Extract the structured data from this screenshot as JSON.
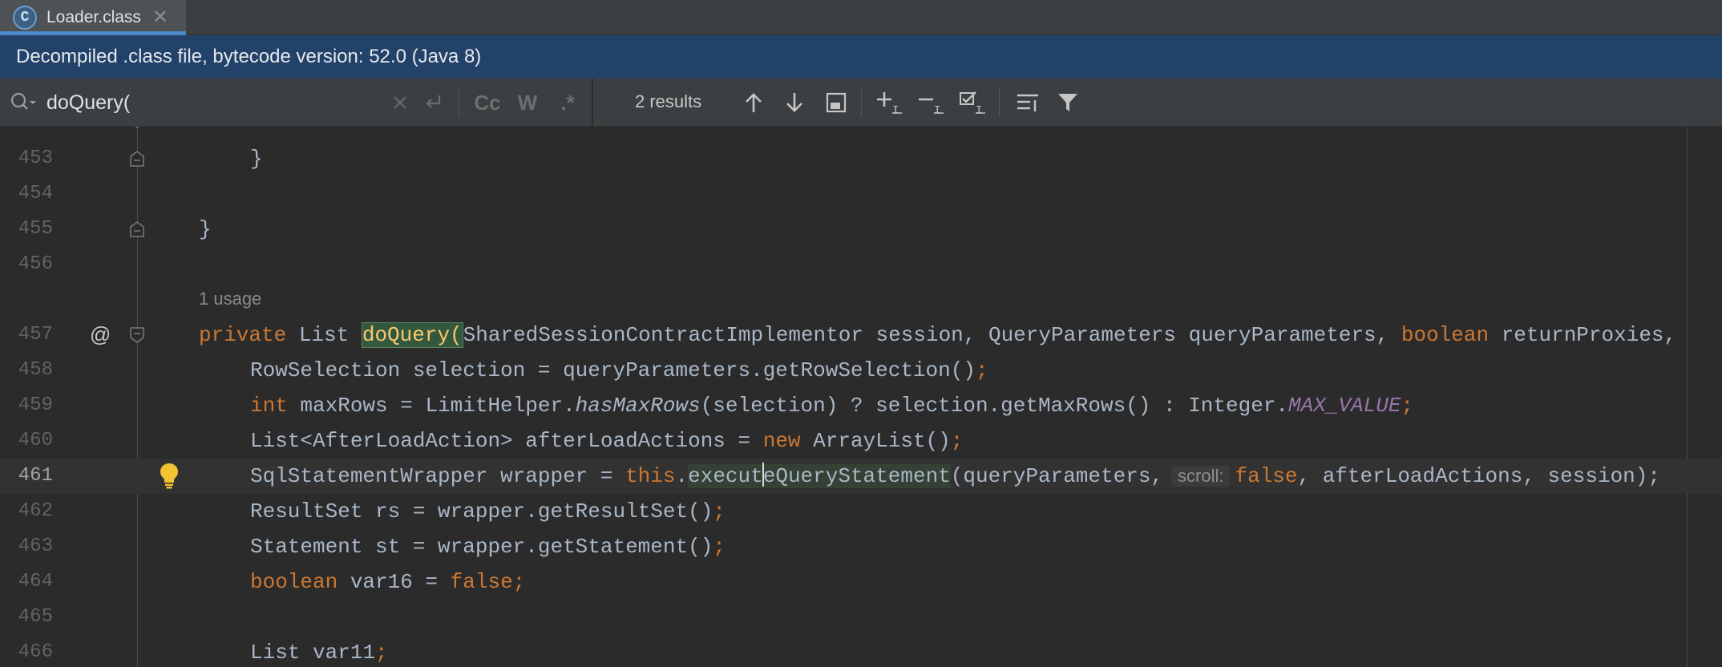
{
  "tab": {
    "icon": "class-file-icon",
    "icon_glyph": "C",
    "label": "Loader.class",
    "close_glyph": "✕"
  },
  "banner": {
    "text": "Decompiled .class file, bytecode version: 52.0 (Java 8)"
  },
  "search": {
    "query": "doQuery(",
    "results_label": "2 results",
    "options": {
      "match_case": "Cc",
      "words": "W",
      "regex": ".*"
    }
  },
  "editor": {
    "lines": {
      "l453": {
        "num": "453",
        "text": "}"
      },
      "l454": {
        "num": "454"
      },
      "l455": {
        "num": "455",
        "text": "}"
      },
      "l456": {
        "num": "456"
      },
      "usage": "1 usage",
      "l457": {
        "num": "457",
        "kw_private": "private",
        "type_list": " List ",
        "fn": "doQuery(",
        "rest": "SharedSessionContractImplementor session, QueryParameters queryParameters, ",
        "kw_boolean": "boolean",
        "rest2": " returnProxies,"
      },
      "l458": {
        "num": "458",
        "a": "RowSelection selection = queryParameters.getRowSelection()",
        "semi": ";"
      },
      "l459": {
        "num": "459",
        "kw_int": "int",
        "a": " maxRows = LimitHelper.",
        "static_call": "hasMaxRows",
        "b": "(selection) ? selection.getMaxRows() : Integer.",
        "const": "MAX_VALUE",
        "semi": ";"
      },
      "l460": {
        "num": "460",
        "a": "List<AfterLoadAction> afterLoadActions = ",
        "kw_new": "new",
        "b": " ArrayList()",
        "semi": ";"
      },
      "l461": {
        "num": "461",
        "a": "SqlStatementWrapper wrapper = ",
        "kw_this": "this",
        "dot": ".",
        "exec1": "execut",
        "exec2": "eQueryStatement",
        "b": "(queryParameters,",
        "hint": "scroll:",
        "kw_false": "false",
        "c": ", afterLoadActions, session);"
      },
      "l462": {
        "num": "462",
        "a": "ResultSet rs = wrapper.getResultSet()",
        "semi": ";"
      },
      "l463": {
        "num": "463",
        "a": "Statement st = wrapper.getStatement()",
        "semi": ";"
      },
      "l464": {
        "num": "464",
        "kw_boolean": "boolean",
        "a": " var16 = ",
        "kw_false": "false",
        "semi": ";"
      },
      "l465": {
        "num": "465"
      },
      "l466": {
        "num": "466",
        "a": "List var11",
        "semi": ";"
      }
    }
  },
  "colors": {
    "editor_bg": "#2b2b2b",
    "keyword": "#cc7832",
    "function_decl": "#ffc66d",
    "constant": "#9876aa",
    "banner_bg": "#234269",
    "tab_underline": "#4a88c7"
  }
}
